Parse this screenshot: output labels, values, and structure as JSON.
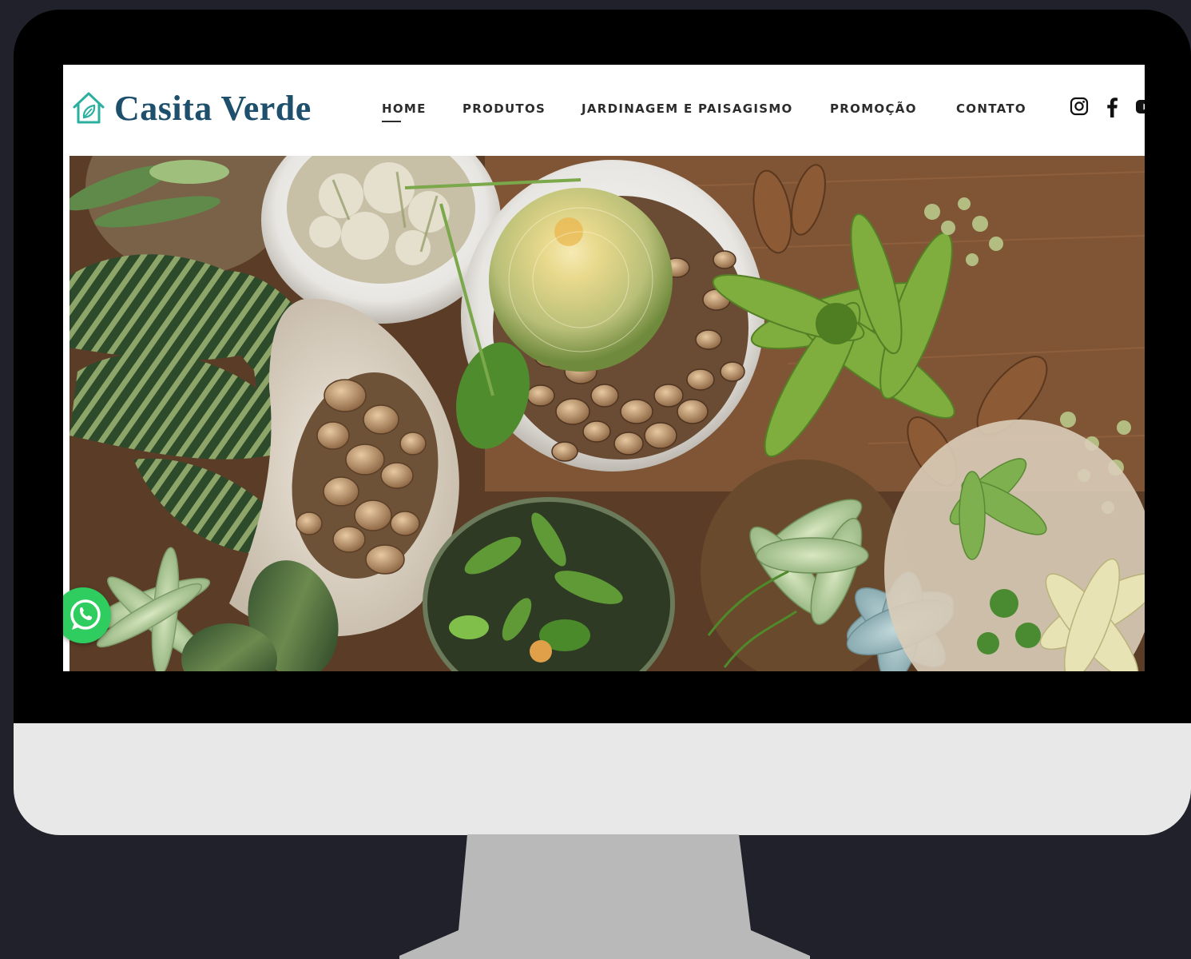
{
  "site": {
    "brand_name": "Casita Verde",
    "brand_color": "#1e4f6c",
    "logo_icon": "house-leaf-icon",
    "logo_icon_color": "#2bb0a0"
  },
  "nav": {
    "items": [
      {
        "label": "HOME",
        "active": true
      },
      {
        "label": "PRODUTOS",
        "active": false
      },
      {
        "label": "JARDINAGEM E PAISAGISMO",
        "active": false
      },
      {
        "label": "PROMOÇÃO",
        "active": false
      },
      {
        "label": "CONTATO",
        "active": false
      }
    ]
  },
  "social": {
    "icons": [
      "instagram-icon",
      "facebook-icon",
      "youtube-icon"
    ]
  },
  "hero": {
    "subject": "plants",
    "image_icon": "potted-succulents-cactus-image"
  },
  "floating": {
    "whatsapp_icon": "whatsapp-icon",
    "whatsapp_color": "#2fcc5f"
  },
  "device": {
    "frame_color": "#000000",
    "chin_color": "#e8e8e8",
    "stand_color": "#b9b9b9",
    "background": "#20212a"
  }
}
